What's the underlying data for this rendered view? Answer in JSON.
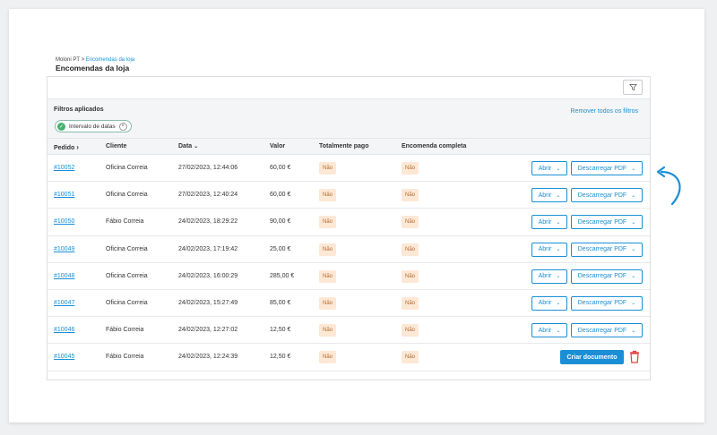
{
  "breadcrumb": {
    "root": "Moloni PT",
    "sep": " > ",
    "current": "Encomendas da loja"
  },
  "page_title": "Encomendas da loja",
  "filters": {
    "title": "Filtros aplicados",
    "chip_label": "Intervalo de datas",
    "remove_all": "Remover todos os filtros"
  },
  "columns": {
    "order": "Pedido",
    "client": "Cliente",
    "date": "Data",
    "value": "Valor",
    "paid": "Totalmente pago",
    "complete": "Encomenda completa"
  },
  "actions": {
    "open": "Abrir",
    "download_pdf": "Descarregar PDF",
    "create_document": "Criar documento"
  },
  "rows": [
    {
      "order": "#10052",
      "client": "Oficina Correia",
      "date": "27/02/2023, 12:44:06",
      "value": "60,00 €",
      "paid": "Não",
      "complete": "Não"
    },
    {
      "order": "#10051",
      "client": "Oficina Correia",
      "date": "27/02/2023, 12:40:24",
      "value": "60,00 €",
      "paid": "Não",
      "complete": "Não"
    },
    {
      "order": "#10050",
      "client": "Fábio Correia",
      "date": "24/02/2023, 18:29:22",
      "value": "90,00 €",
      "paid": "Não",
      "complete": "Não"
    },
    {
      "order": "#10049",
      "client": "Oficina Correia",
      "date": "24/02/2023, 17:19:42",
      "value": "25,00 €",
      "paid": "Não",
      "complete": "Não"
    },
    {
      "order": "#10048",
      "client": "Oficina Correia",
      "date": "24/02/2023, 16:00:29",
      "value": "285,00 €",
      "paid": "Não",
      "complete": "Não"
    },
    {
      "order": "#10047",
      "client": "Oficina Correia",
      "date": "24/02/2023, 15:27:49",
      "value": "85,00 €",
      "paid": "Não",
      "complete": "Não"
    },
    {
      "order": "#10046",
      "client": "Fábio Correia",
      "date": "24/02/2023, 12:27:02",
      "value": "12,50 €",
      "paid": "Não",
      "complete": "Não"
    },
    {
      "order": "#10045",
      "client": "Fábio Correia",
      "date": "24/02/2023, 12:24:39",
      "value": "12,50 €",
      "paid": "Não",
      "complete": "Não"
    }
  ],
  "colors": {
    "accent": "#1a8fd6",
    "badge_bg": "#fde8d6",
    "badge_text": "#b36a2e",
    "danger": "#e0403a",
    "success": "#43b36b"
  },
  "icons": {
    "filter": "funnel-icon",
    "check": "check-icon",
    "close": "close-icon",
    "trash": "trash-icon",
    "sort": "chevron-right-icon",
    "sort_date": "chevron-down-icon",
    "annotation": "curved-arrow-icon"
  }
}
